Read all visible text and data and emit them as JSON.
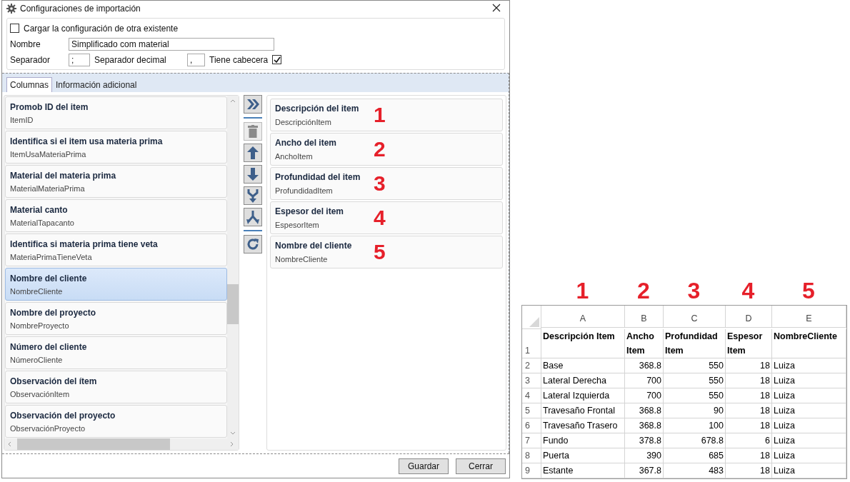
{
  "window": {
    "title": "Configuraciones de importación"
  },
  "load_existing": {
    "label": "Cargar la configuración de otra existente",
    "checked": false
  },
  "name_field": {
    "label": "Nombre",
    "value": "Simplificado com material"
  },
  "separator_field": {
    "label": "Separador",
    "value": ";"
  },
  "decimal_field": {
    "label": "Separador decimal",
    "value": ","
  },
  "has_header": {
    "label": "Tiene cabecera",
    "checked": true
  },
  "tabs": [
    {
      "label": "Columnas",
      "selected": true
    },
    {
      "label": "Información adicional",
      "selected": false
    }
  ],
  "available_columns": [
    {
      "title": "Promob ID del item",
      "field": "ItemID",
      "selected": false
    },
    {
      "title": "Identifica si el item usa materia prima",
      "field": "ItemUsaMateriaPrima",
      "selected": false
    },
    {
      "title": "Material del materia prima",
      "field": "MaterialMateriaPrima",
      "selected": false
    },
    {
      "title": "Material canto",
      "field": "MaterialTapacanto",
      "selected": false
    },
    {
      "title": "Identifica si materia prima tiene veta",
      "field": "MateriaPrimaTieneVeta",
      "selected": false
    },
    {
      "title": "Nombre del cliente",
      "field": "NombreCliente",
      "selected": true
    },
    {
      "title": "Nombre del proyecto",
      "field": "NombreProyecto",
      "selected": false
    },
    {
      "title": "Número del cliente",
      "field": "NúmeroCliente",
      "selected": false
    },
    {
      "title": "Observación del ítem",
      "field": "ObservaciónItem",
      "selected": false
    },
    {
      "title": "Observación del proyecto",
      "field": "ObservaciónProyecto",
      "selected": false
    }
  ],
  "toolbar": [
    [
      {
        "kind": "add-all",
        "disabled": false
      }
    ],
    [
      {
        "kind": "delete",
        "disabled": true
      },
      {
        "kind": "up",
        "disabled": false
      },
      {
        "kind": "down",
        "disabled": false
      },
      {
        "kind": "merge",
        "disabled": false
      },
      {
        "kind": "split",
        "disabled": false
      }
    ],
    [
      {
        "kind": "refresh",
        "disabled": false
      }
    ]
  ],
  "selected_columns": [
    {
      "title": "Descripción del item",
      "field": "DescripciónItem",
      "annotation": "1"
    },
    {
      "title": "Ancho del item",
      "field": "AnchoItem",
      "annotation": "2"
    },
    {
      "title": "Profundidad del item",
      "field": "ProfundidadItem",
      "annotation": "3"
    },
    {
      "title": "Espesor del item",
      "field": "EspesorItem",
      "annotation": "4"
    },
    {
      "title": "Nombre del cliente",
      "field": "NombreCliente",
      "annotation": "5"
    }
  ],
  "buttons": [
    "Guardar",
    "Cerrar"
  ],
  "spreadsheet": {
    "annotations": [
      "1",
      "2",
      "3",
      "4",
      "5"
    ],
    "column_letters": [
      "A",
      "B",
      "C",
      "D",
      "E"
    ],
    "numeric": [
      false,
      true,
      true,
      true,
      false
    ],
    "header_row": {
      "number": "1",
      "cells": [
        "Descripción Item",
        "Ancho Item",
        "Profundidad Item",
        "Espesor Item",
        "NombreCliente"
      ]
    },
    "rows": [
      {
        "number": "2",
        "cells": [
          "Base",
          "368.8",
          "550",
          "18",
          "Luiza"
        ]
      },
      {
        "number": "3",
        "cells": [
          "Lateral Derecha",
          "700",
          "550",
          "18",
          "Luiza"
        ]
      },
      {
        "number": "4",
        "cells": [
          "Lateral Izquierda",
          "700",
          "550",
          "18",
          "Luiza"
        ]
      },
      {
        "number": "5",
        "cells": [
          "Travesaño Frontal",
          "368.8",
          "90",
          "18",
          "Luiza"
        ]
      },
      {
        "number": "6",
        "cells": [
          "Travesaño Trasero",
          "368.8",
          "100",
          "18",
          "Luiza"
        ]
      },
      {
        "number": "7",
        "cells": [
          "Fundo",
          "378.8",
          "678.8",
          "6",
          "Luiza"
        ]
      },
      {
        "number": "8",
        "cells": [
          "Puerta",
          "390",
          "685",
          "18",
          "Luiza"
        ]
      },
      {
        "number": "9",
        "cells": [
          "Estante",
          "367.8",
          "483",
          "18",
          "Luiza"
        ]
      }
    ]
  }
}
